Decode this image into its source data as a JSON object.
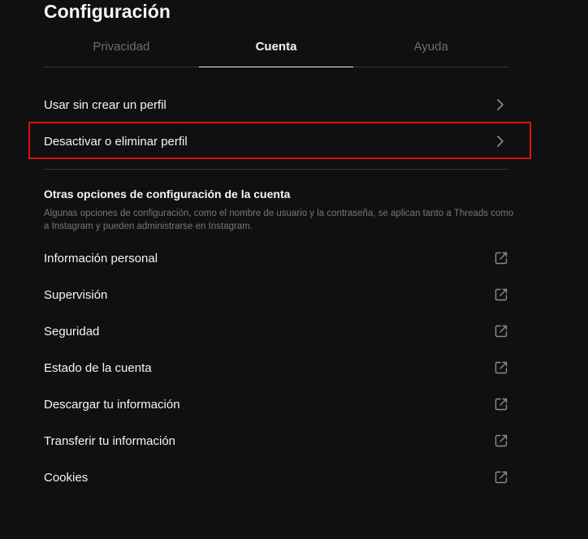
{
  "header": {
    "title": "Configuración"
  },
  "tabs": [
    {
      "label": "Privacidad",
      "active": false
    },
    {
      "label": "Cuenta",
      "active": true
    },
    {
      "label": "Ayuda",
      "active": false
    }
  ],
  "account_items": [
    {
      "label": "Usar sin crear un perfil",
      "icon": "chevron-right-icon"
    },
    {
      "label": "Desactivar o eliminar perfil",
      "icon": "chevron-right-icon",
      "highlighted": true
    }
  ],
  "other_options": {
    "title": "Otras opciones de configuración de la cuenta",
    "description": "Algunas opciones de configuración, como el nombre de usuario y la contraseña, se aplican tanto a Threads como a Instagram y pueden administrarse en Instagram.",
    "items": [
      {
        "label": "Información personal",
        "icon": "external-link-icon"
      },
      {
        "label": "Supervisión",
        "icon": "external-link-icon"
      },
      {
        "label": "Seguridad",
        "icon": "external-link-icon"
      },
      {
        "label": "Estado de la cuenta",
        "icon": "external-link-icon"
      },
      {
        "label": "Descargar tu información",
        "icon": "external-link-icon"
      },
      {
        "label": "Transferir tu información",
        "icon": "external-link-icon"
      },
      {
        "label": "Cookies",
        "icon": "external-link-icon"
      }
    ]
  },
  "colors": {
    "background": "#101010",
    "text_primary": "#f3f5f7",
    "text_muted": "#777777",
    "divider": "#333638",
    "highlight": "#e10f14"
  }
}
